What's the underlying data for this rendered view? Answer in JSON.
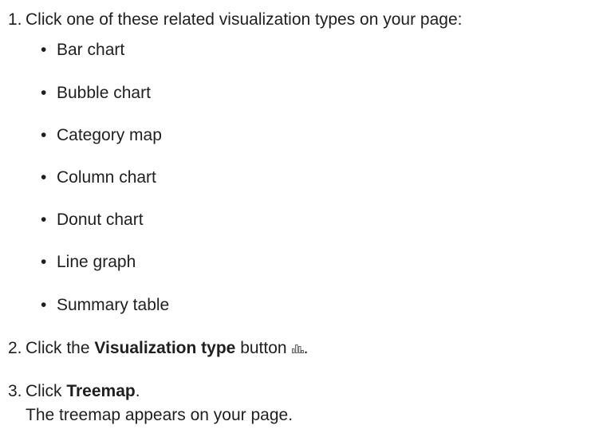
{
  "steps": [
    {
      "number": "1.",
      "text": "Click one of these related visualization types on your page:",
      "bullets": [
        "Bar chart",
        "Bubble chart",
        "Category map",
        "Column chart",
        "Donut chart",
        "Line graph",
        "Summary table"
      ]
    },
    {
      "number": "2.",
      "prefix": "Click the ",
      "bold": "Visualization type",
      "suffix": " button",
      "end": ".",
      "icon": "visualization-type-icon"
    },
    {
      "number": "3.",
      "prefix": "Click ",
      "bold": "Treemap",
      "end": ".",
      "result": "The treemap appears on your page."
    }
  ],
  "bullet_glyph": "•"
}
